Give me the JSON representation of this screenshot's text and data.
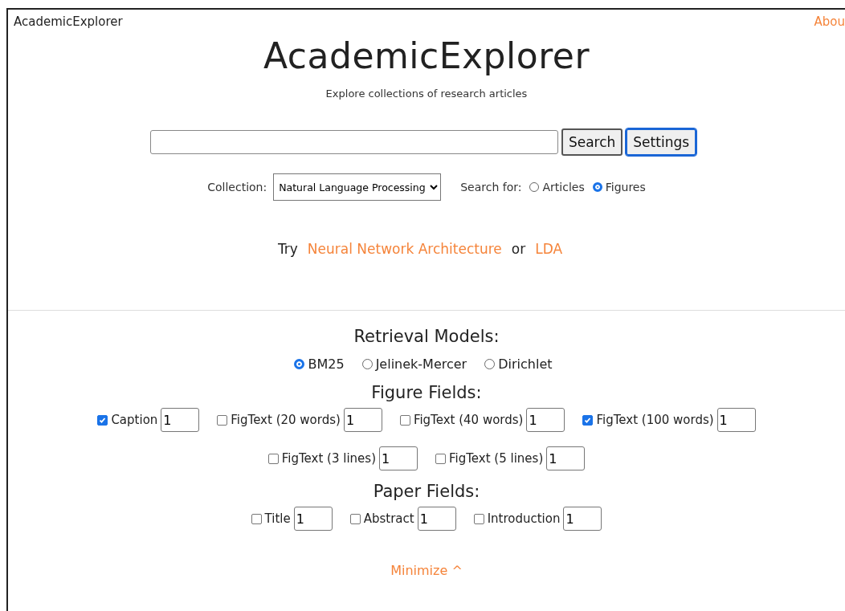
{
  "nav": {
    "brand": "AcademicExplorer",
    "about_link": "Abou"
  },
  "hero": {
    "title": "AcademicExplorer",
    "subtitle": "Explore collections of research articles"
  },
  "search": {
    "buttons": [
      {
        "label": "Search",
        "focused": false
      },
      {
        "label": "Settings",
        "focused": true
      }
    ]
  },
  "collection": {
    "label": "Collection:",
    "value": "Natural Language Processing"
  },
  "search_for": {
    "label": "Search for:",
    "options": [
      {
        "label": "Articles",
        "selected": false
      },
      {
        "label": "Figures",
        "selected": true
      }
    ]
  },
  "suggestions": [
    {
      "kind": "text",
      "text": "Try"
    },
    {
      "kind": "link",
      "text": "Neural Network Architecture"
    },
    {
      "kind": "text",
      "text": "or"
    },
    {
      "kind": "link",
      "text": "LDA"
    }
  ],
  "settings": {
    "retrieval_models": {
      "heading": "Retrieval Models:",
      "options": [
        {
          "label": "BM25",
          "selected": true
        },
        {
          "label": "Jelinek-Mercer",
          "selected": false
        },
        {
          "label": "Dirichlet",
          "selected": false
        }
      ]
    },
    "figure_fields": {
      "heading": "Figure Fields:",
      "rows": [
        {
          "fields": [
            {
              "label": "Caption",
              "checked": true,
              "weight": "1"
            },
            {
              "label": "FigText (20 words)",
              "checked": false,
              "weight": "1"
            },
            {
              "label": "FigText (40 words)",
              "checked": false,
              "weight": "1"
            },
            {
              "label": "FigText (100 words)",
              "checked": true,
              "weight": "1"
            }
          ]
        },
        {
          "fields": [
            {
              "label": "FigText (3 lines)",
              "checked": false,
              "weight": "1"
            },
            {
              "label": "FigText (5 lines)",
              "checked": false,
              "weight": "1"
            }
          ]
        }
      ]
    },
    "paper_fields": {
      "heading": "Paper Fields:",
      "rows": [
        {
          "fields": [
            {
              "label": "Title",
              "checked": false,
              "weight": "1"
            },
            {
              "label": "Abstract",
              "checked": false,
              "weight": "1"
            },
            {
              "label": "Introduction",
              "checked": false,
              "weight": "1"
            }
          ]
        }
      ]
    },
    "minimize_link": "Minimize ^"
  }
}
